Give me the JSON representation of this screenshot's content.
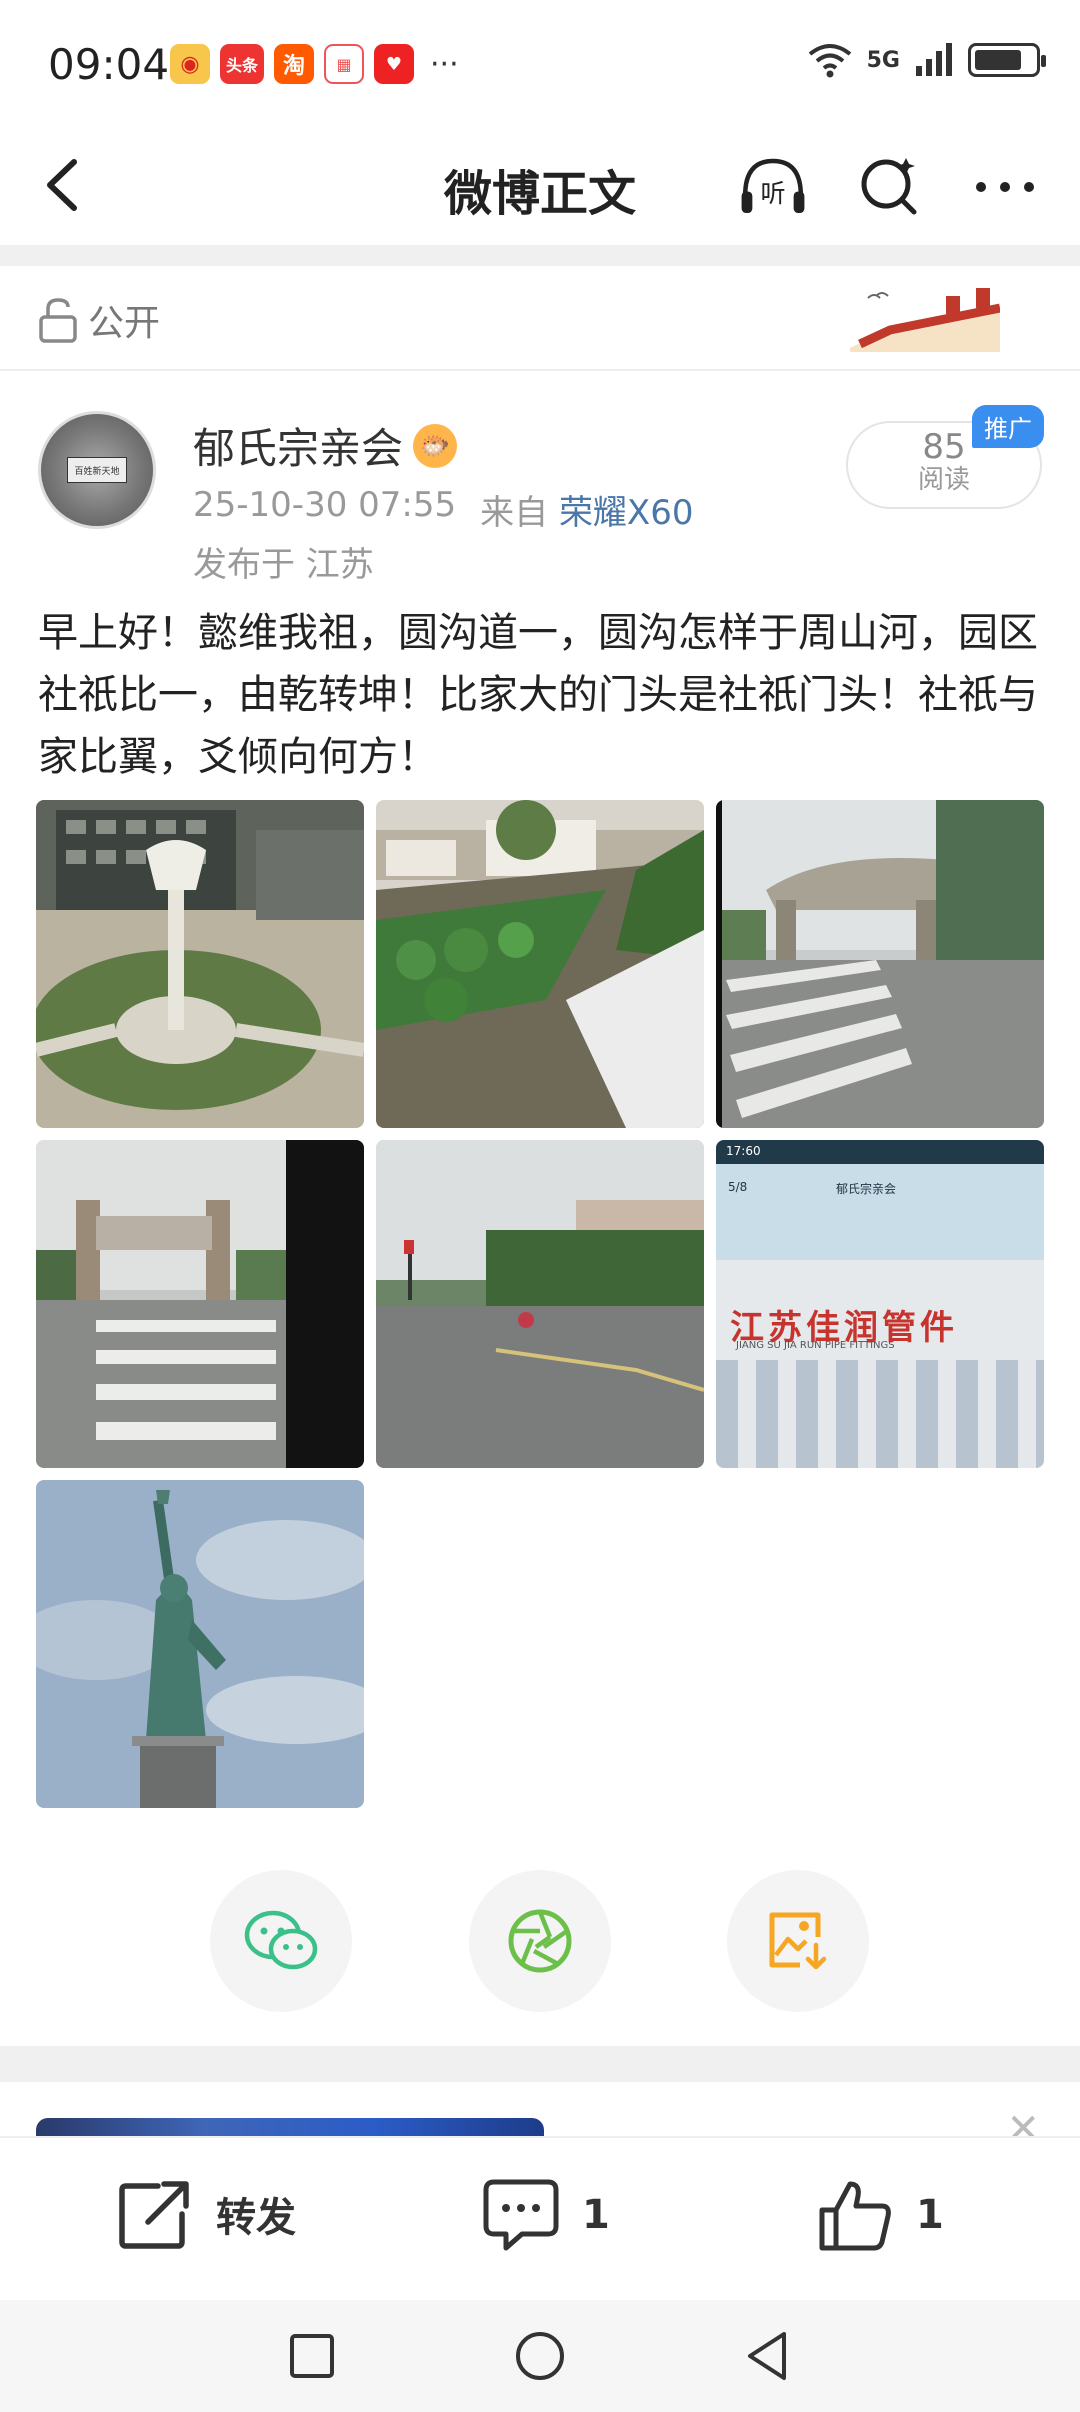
{
  "status_bar": {
    "time": "09:04",
    "notification_icons": [
      "weibo-icon",
      "toutiao-icon",
      "taobao-icon",
      "calendar-icon",
      "tmall-icon"
    ],
    "toutiao_label": "头条",
    "taobao_label": "淘",
    "more": "···",
    "network": "5G",
    "battery_level": 0.8
  },
  "header": {
    "title": "微博正文"
  },
  "visibility": {
    "label": "公开"
  },
  "author": {
    "name": "郁氏宗亲会",
    "avatar_text": "百姓新天地",
    "timestamp": "25-10-30 07:55",
    "source_prefix": "来自",
    "device": "荣耀X60",
    "location": "发布于 江苏",
    "read_count": "85",
    "read_label": "阅读",
    "promo_tag": "推广"
  },
  "post": {
    "text": "早上好！懿维我祖，圆沟道一，圆沟怎样于周山河，园区社祇比一，由乾转坤！比家大的门头是社祇门头！社祇与家比翼，爻倾向何方！"
  },
  "images": {
    "count": 7,
    "screenshot_text": {
      "time": "17:60",
      "page": "5/8",
      "title": "郁氏宗亲会",
      "sign": "江苏佳润管件",
      "sign_sub": "JIANG SU JIA RUN PIPE FITTINGS"
    }
  },
  "actions": {
    "forward_label": "转发",
    "comment_count": "1",
    "like_count": "1"
  },
  "colors": {
    "accent_blue": "#4a76a8",
    "promo_blue": "#3a8ef0",
    "wechat_green": "#3cc08a",
    "moments_green": "#6cc04a",
    "save_orange": "#f5a623"
  }
}
